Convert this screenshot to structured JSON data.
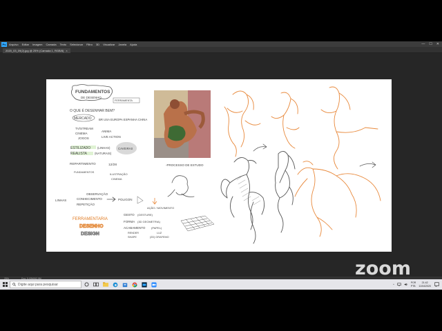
{
  "app": {
    "logo": "Ps",
    "menu": [
      "Arquivo",
      "Editar",
      "Imagem",
      "Camada",
      "Texto",
      "Selecionar",
      "Filtro",
      "3D",
      "Visualizar",
      "Janela",
      "Ajuda"
    ],
    "window_controls": [
      "—",
      "☐",
      "✕"
    ]
  },
  "document": {
    "tab_title": "2020_03_09(2).jpg @ 25% (Camada 1, RGB/8)",
    "tab_close": "×"
  },
  "statusbar": {
    "zoom": "25%",
    "doc_info": "Doc: 5,93M/62,9M"
  },
  "artboard": {
    "notes": {
      "title_line1": "FUNDAMENTOS",
      "title_line2": "DE DESENHO",
      "tag_ferramenta": "FERRAMENTA",
      "q1": "O QUE É DESENHAR BEM?",
      "mercado": "MERCADO",
      "mercado_regions": "BR USA EUROPA ESPANHA CHINA",
      "tv_streaming": "TV/STREAM",
      "cinema": "CINEMA",
      "jogos": "JOGOS",
      "anima": "ANIMA",
      "live_action": "LIVE ACTION",
      "estilizado": "ESTILIZADO",
      "realista": "REALISTA",
      "linhas": "(LINHAS)",
      "naturais": "(NATURAIS)",
      "caveiras": "CAVEIRAS",
      "repartimento": "REPARTIMENTO",
      "fundamentos": "FUNDAMENTOS",
      "nums": "12/28",
      "ilustracao": "ILUSTRAÇÃO",
      "cinema2": "CINEMA",
      "observacao": "OBSERVAÇÃO",
      "conhecimento": "CONHECIMENTO",
      "repeticao": "REPETIÇÃO",
      "linhas2": "LINHAS",
      "polygon": "POLIGON",
      "ferramentaria": "FERRAMENTARIA",
      "desenho": "DESENHO",
      "design": "DESIGN",
      "gesto": "GESTO",
      "gesto_sub": "(GESTURE)",
      "acao": "AÇÃO / MOVIMENTO",
      "forma": "FORMA",
      "forma_sub": "(3D GEOMETRIA)",
      "acabamento": "ACABAMENTO",
      "acabamento_sub": "(PAPEL)",
      "render": "RENDER",
      "shape": "SHAPE",
      "shape_sub": "(2D) GRAFEMO",
      "luz": "LUZ",
      "caption_photo": "-PROCESSO DE ESTUDO"
    }
  },
  "watermark": "zoom",
  "taskbar": {
    "search_placeholder": "Digite aqui para pesquisar",
    "tray_lang_top": "POR",
    "tray_lang_bottom": "PTB",
    "time": "21:42",
    "date": "11/04/2020"
  },
  "colors": {
    "accent": "#31a8ff",
    "orange_sketch": "#e8883a",
    "graphite": "#555555",
    "highlight": "#c7e8b5",
    "fresco_red": "#b5523b"
  }
}
